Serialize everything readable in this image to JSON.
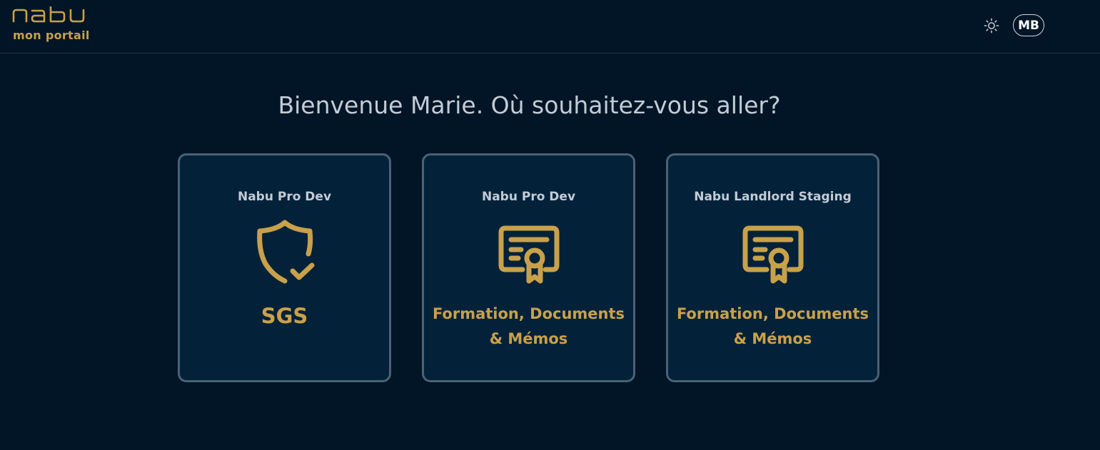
{
  "header": {
    "logo_text": "nabu",
    "subtitle": "mon portail",
    "avatar_initials": "MB"
  },
  "welcome": "Bienvenue Marie. Où souhaitez-vous aller?",
  "cards": [
    {
      "environment": "Nabu Pro Dev",
      "title": "SGS",
      "icon": "shield-check-icon"
    },
    {
      "environment": "Nabu Pro Dev",
      "title": "Formation, Documents & Mémos",
      "icon": "certificate-icon"
    },
    {
      "environment": "Nabu Landlord Staging",
      "title": "Formation, Documents & Mémos",
      "icon": "certificate-icon"
    }
  ],
  "colors": {
    "background": "#011526",
    "card_background": "#03223a",
    "card_border": "#4a6275",
    "accent_gold": "#c9a14a",
    "text_light": "#c3cbd6"
  }
}
